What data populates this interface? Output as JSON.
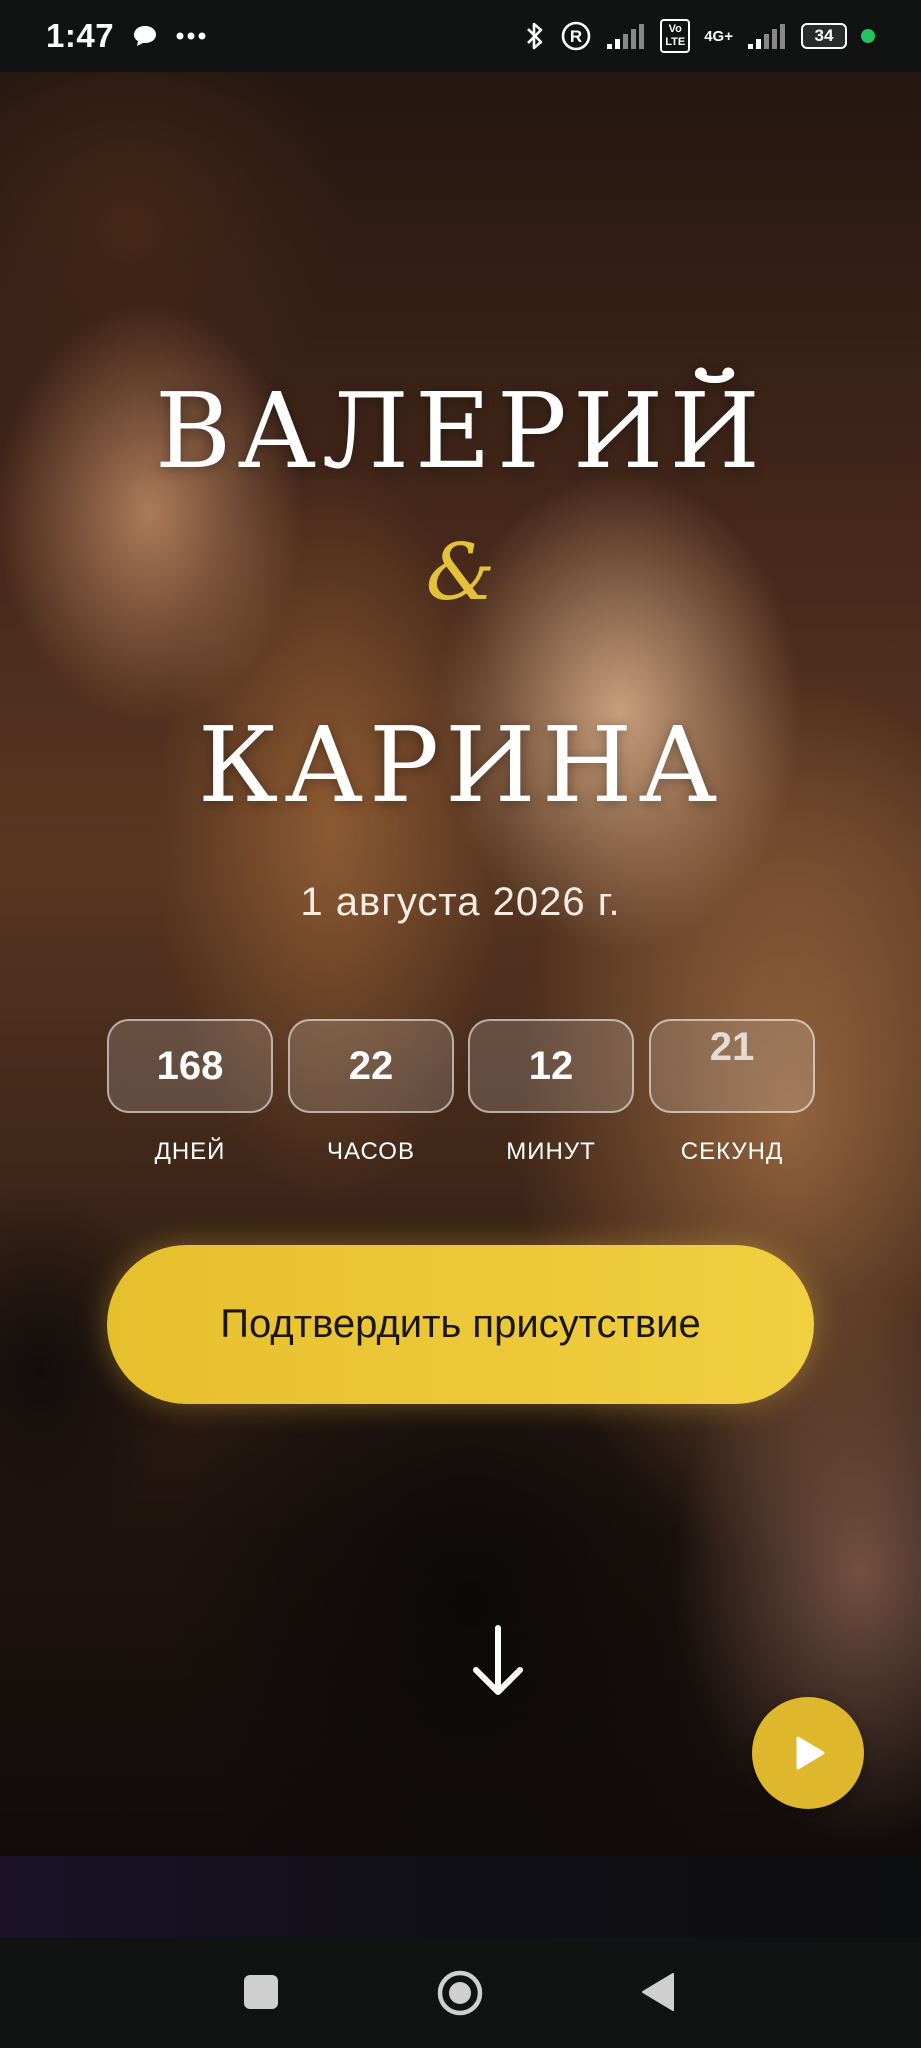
{
  "status_bar": {
    "time": "1:47",
    "battery": "34",
    "volte_label": "Vo LTE",
    "network_label": "4G+"
  },
  "hero": {
    "name_1": "ВАЛЕРИЙ",
    "ampersand": "&",
    "name_2": "КАРИНА",
    "date": "1 августа 2026 г.",
    "countdown": [
      {
        "value": "168",
        "label": "ДНЕЙ"
      },
      {
        "value": "22",
        "label": "ЧАСОВ"
      },
      {
        "value": "12",
        "label": "МИНУТ"
      },
      {
        "value": "21",
        "label": "СЕКУНД"
      }
    ],
    "rsvp_label": "Подтвердить присутствие"
  },
  "icons": {
    "scroll": "arrow-down-icon",
    "music": "play-icon"
  },
  "colors": {
    "accent": "#e6bf2d",
    "ampersand": "#e3c13a",
    "status_dot": "#22c55e"
  }
}
